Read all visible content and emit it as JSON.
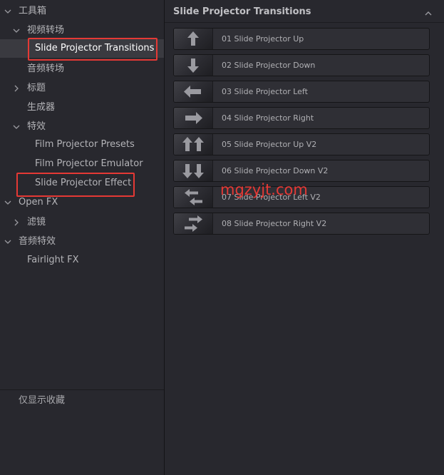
{
  "sidebar": {
    "toolbox_label": "工具箱",
    "video_transitions_label": "视频转场",
    "slide_projector_transitions_label": "Slide Projector Transitions",
    "audio_transitions_label": "音频转场",
    "titles_label": "标题",
    "generators_label": "生成器",
    "effects_label": "特效",
    "film_projector_presets_label": "Film Projector Presets",
    "film_projector_emulator_label": "Film Projector Emulator",
    "slide_projector_effect_label": "Slide Projector Effect",
    "open_fx_label": "Open FX",
    "filters_label": "滤镜",
    "audio_effects_label": "音频特效",
    "fairlight_fx_label": "Fairlight FX",
    "favorites_only_label": "仅显示收藏"
  },
  "panel": {
    "title": "Slide Projector Transitions",
    "items": [
      {
        "label": "01 Slide Projector Up",
        "icon": "arrow-up-icon"
      },
      {
        "label": "02 Slide Projector Down",
        "icon": "arrow-down-icon"
      },
      {
        "label": "03 Slide Projector Left",
        "icon": "arrow-left-icon"
      },
      {
        "label": "04 Slide Projector Right",
        "icon": "arrow-right-icon"
      },
      {
        "label": "05 Slide Projector Up V2",
        "icon": "double-arrow-up-icon"
      },
      {
        "label": "06 Slide Projector Down V2",
        "icon": "double-arrow-down-icon"
      },
      {
        "label": "07 Slide Projector Left V2",
        "icon": "double-arrow-left-icon"
      },
      {
        "label": "08 Slide Projector Right V2",
        "icon": "double-arrow-right-icon"
      }
    ]
  },
  "watermark": "mgzyjt.com",
  "colors": {
    "background": "#28282e",
    "selected_row": "#3a3a40",
    "highlight_box": "#e53935",
    "watermark": "#e53935"
  }
}
